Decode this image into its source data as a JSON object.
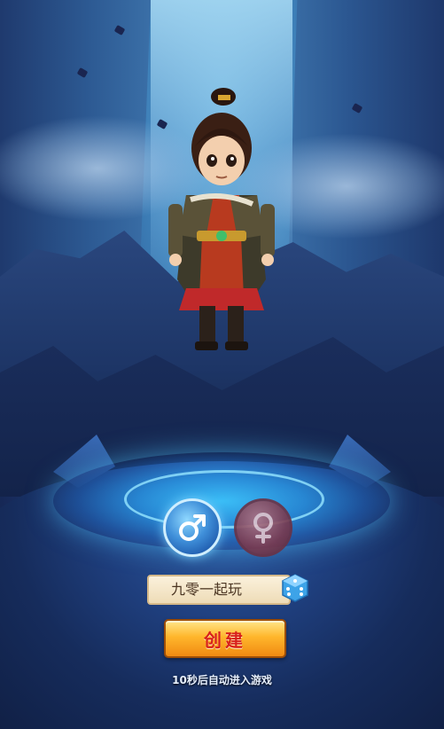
{
  "scene": {
    "character": "male-warrior-character"
  },
  "gender": {
    "male_icon": "male-symbol-icon",
    "female_icon": "female-symbol-icon",
    "selected": "male"
  },
  "name_field": {
    "value": "九零一起玩",
    "random_icon": "dice-icon"
  },
  "create_button": {
    "label": "创建"
  },
  "auto_enter_hint": "10秒后自动进入游戏",
  "colors": {
    "accent_blue": "#3f8fd9",
    "button_orange": "#ffb62c",
    "button_text_red": "#d8201b"
  }
}
